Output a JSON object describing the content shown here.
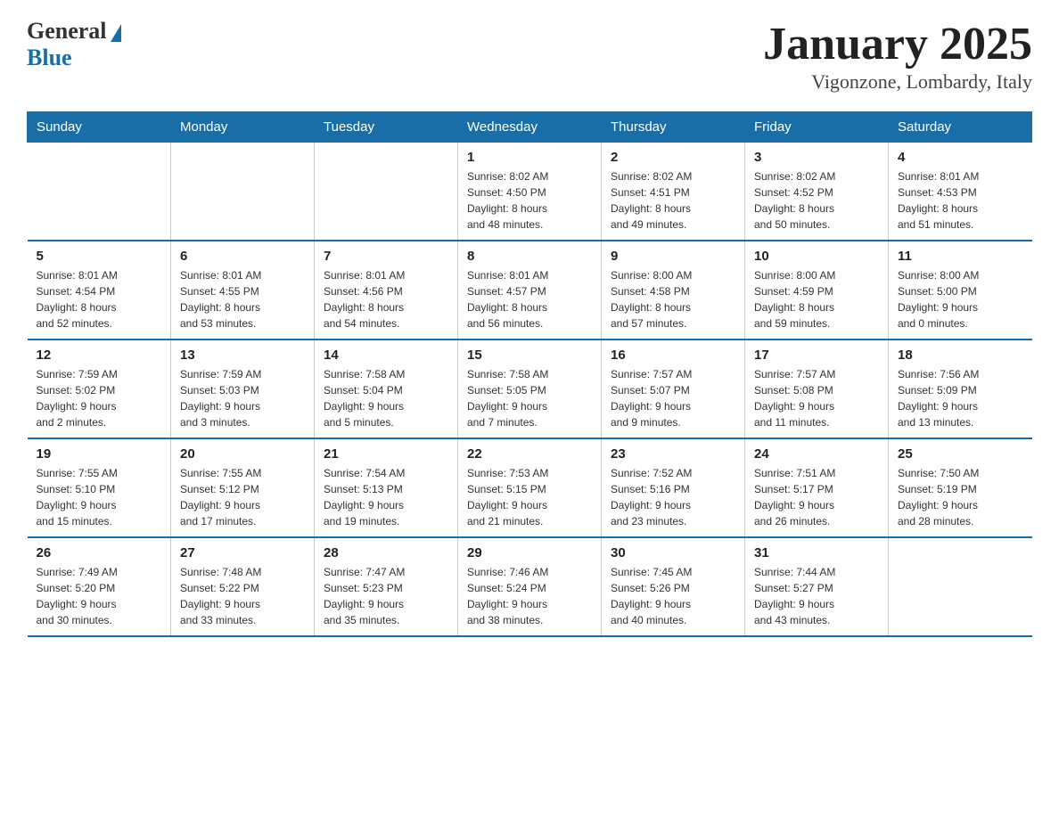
{
  "logo": {
    "general": "General",
    "blue": "Blue"
  },
  "title": {
    "month_year": "January 2025",
    "location": "Vigonzone, Lombardy, Italy"
  },
  "headers": [
    "Sunday",
    "Monday",
    "Tuesday",
    "Wednesday",
    "Thursday",
    "Friday",
    "Saturday"
  ],
  "weeks": [
    [
      {
        "day": "",
        "info": ""
      },
      {
        "day": "",
        "info": ""
      },
      {
        "day": "",
        "info": ""
      },
      {
        "day": "1",
        "info": "Sunrise: 8:02 AM\nSunset: 4:50 PM\nDaylight: 8 hours\nand 48 minutes."
      },
      {
        "day": "2",
        "info": "Sunrise: 8:02 AM\nSunset: 4:51 PM\nDaylight: 8 hours\nand 49 minutes."
      },
      {
        "day": "3",
        "info": "Sunrise: 8:02 AM\nSunset: 4:52 PM\nDaylight: 8 hours\nand 50 minutes."
      },
      {
        "day": "4",
        "info": "Sunrise: 8:01 AM\nSunset: 4:53 PM\nDaylight: 8 hours\nand 51 minutes."
      }
    ],
    [
      {
        "day": "5",
        "info": "Sunrise: 8:01 AM\nSunset: 4:54 PM\nDaylight: 8 hours\nand 52 minutes."
      },
      {
        "day": "6",
        "info": "Sunrise: 8:01 AM\nSunset: 4:55 PM\nDaylight: 8 hours\nand 53 minutes."
      },
      {
        "day": "7",
        "info": "Sunrise: 8:01 AM\nSunset: 4:56 PM\nDaylight: 8 hours\nand 54 minutes."
      },
      {
        "day": "8",
        "info": "Sunrise: 8:01 AM\nSunset: 4:57 PM\nDaylight: 8 hours\nand 56 minutes."
      },
      {
        "day": "9",
        "info": "Sunrise: 8:00 AM\nSunset: 4:58 PM\nDaylight: 8 hours\nand 57 minutes."
      },
      {
        "day": "10",
        "info": "Sunrise: 8:00 AM\nSunset: 4:59 PM\nDaylight: 8 hours\nand 59 minutes."
      },
      {
        "day": "11",
        "info": "Sunrise: 8:00 AM\nSunset: 5:00 PM\nDaylight: 9 hours\nand 0 minutes."
      }
    ],
    [
      {
        "day": "12",
        "info": "Sunrise: 7:59 AM\nSunset: 5:02 PM\nDaylight: 9 hours\nand 2 minutes."
      },
      {
        "day": "13",
        "info": "Sunrise: 7:59 AM\nSunset: 5:03 PM\nDaylight: 9 hours\nand 3 minutes."
      },
      {
        "day": "14",
        "info": "Sunrise: 7:58 AM\nSunset: 5:04 PM\nDaylight: 9 hours\nand 5 minutes."
      },
      {
        "day": "15",
        "info": "Sunrise: 7:58 AM\nSunset: 5:05 PM\nDaylight: 9 hours\nand 7 minutes."
      },
      {
        "day": "16",
        "info": "Sunrise: 7:57 AM\nSunset: 5:07 PM\nDaylight: 9 hours\nand 9 minutes."
      },
      {
        "day": "17",
        "info": "Sunrise: 7:57 AM\nSunset: 5:08 PM\nDaylight: 9 hours\nand 11 minutes."
      },
      {
        "day": "18",
        "info": "Sunrise: 7:56 AM\nSunset: 5:09 PM\nDaylight: 9 hours\nand 13 minutes."
      }
    ],
    [
      {
        "day": "19",
        "info": "Sunrise: 7:55 AM\nSunset: 5:10 PM\nDaylight: 9 hours\nand 15 minutes."
      },
      {
        "day": "20",
        "info": "Sunrise: 7:55 AM\nSunset: 5:12 PM\nDaylight: 9 hours\nand 17 minutes."
      },
      {
        "day": "21",
        "info": "Sunrise: 7:54 AM\nSunset: 5:13 PM\nDaylight: 9 hours\nand 19 minutes."
      },
      {
        "day": "22",
        "info": "Sunrise: 7:53 AM\nSunset: 5:15 PM\nDaylight: 9 hours\nand 21 minutes."
      },
      {
        "day": "23",
        "info": "Sunrise: 7:52 AM\nSunset: 5:16 PM\nDaylight: 9 hours\nand 23 minutes."
      },
      {
        "day": "24",
        "info": "Sunrise: 7:51 AM\nSunset: 5:17 PM\nDaylight: 9 hours\nand 26 minutes."
      },
      {
        "day": "25",
        "info": "Sunrise: 7:50 AM\nSunset: 5:19 PM\nDaylight: 9 hours\nand 28 minutes."
      }
    ],
    [
      {
        "day": "26",
        "info": "Sunrise: 7:49 AM\nSunset: 5:20 PM\nDaylight: 9 hours\nand 30 minutes."
      },
      {
        "day": "27",
        "info": "Sunrise: 7:48 AM\nSunset: 5:22 PM\nDaylight: 9 hours\nand 33 minutes."
      },
      {
        "day": "28",
        "info": "Sunrise: 7:47 AM\nSunset: 5:23 PM\nDaylight: 9 hours\nand 35 minutes."
      },
      {
        "day": "29",
        "info": "Sunrise: 7:46 AM\nSunset: 5:24 PM\nDaylight: 9 hours\nand 38 minutes."
      },
      {
        "day": "30",
        "info": "Sunrise: 7:45 AM\nSunset: 5:26 PM\nDaylight: 9 hours\nand 40 minutes."
      },
      {
        "day": "31",
        "info": "Sunrise: 7:44 AM\nSunset: 5:27 PM\nDaylight: 9 hours\nand 43 minutes."
      },
      {
        "day": "",
        "info": ""
      }
    ]
  ]
}
